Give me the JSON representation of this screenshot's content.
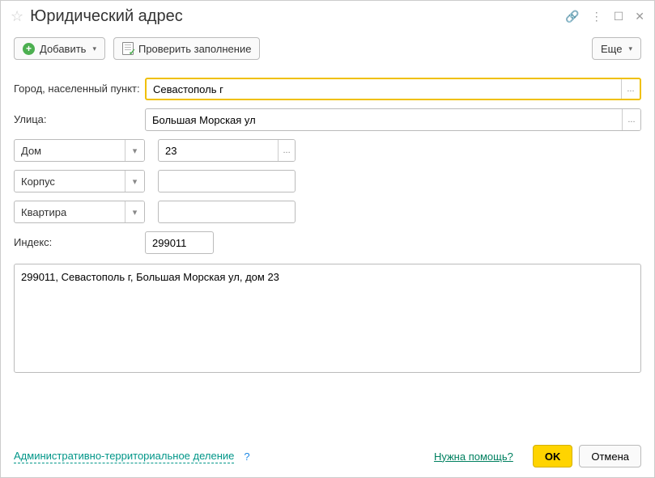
{
  "title": "Юридический адрес",
  "toolbar": {
    "add_label": "Добавить",
    "verify_label": "Проверить заполнение",
    "more_label": "Еще"
  },
  "labels": {
    "city": "Город, населенный пункт:",
    "street": "Улица:",
    "index": "Индекс:"
  },
  "fields": {
    "city_value": "Севастополь г",
    "street_value": "Большая Морская ул",
    "house_type": "Дом",
    "house_value": "23",
    "korpus_type": "Корпус",
    "korpus_value": "",
    "flat_type": "Квартира",
    "flat_value": "",
    "index_value": "299011",
    "full_address": "299011, Севастополь г, Большая Морская ул, дом 23"
  },
  "footer": {
    "adm_division": "Административно-территориальное деление",
    "need_help": "Нужна помощь?",
    "ok": "OK",
    "cancel": "Отмена"
  }
}
